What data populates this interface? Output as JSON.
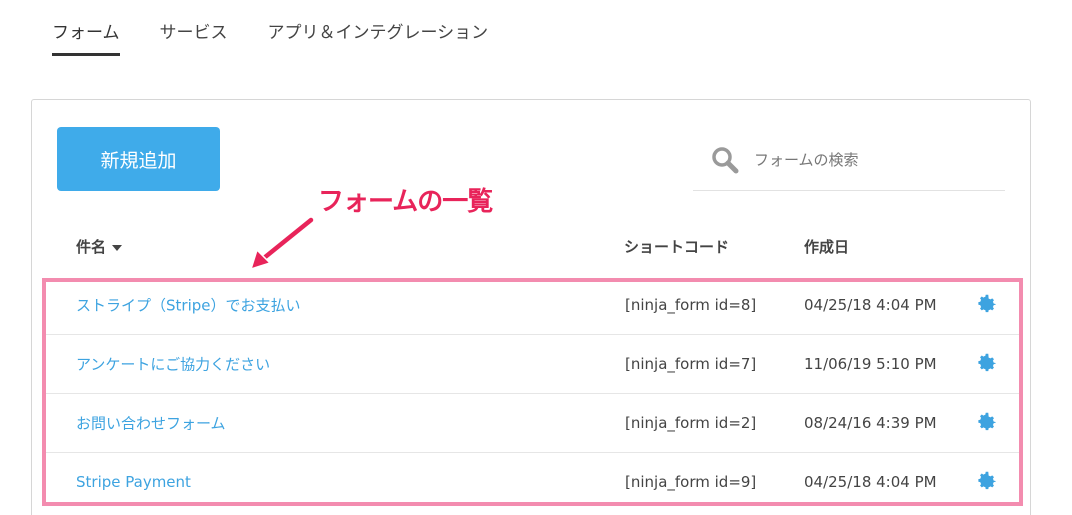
{
  "tabs": [
    {
      "label": "フォーム",
      "active": true
    },
    {
      "label": "サービス",
      "active": false
    },
    {
      "label": "アプリ＆インテグレーション",
      "active": false
    }
  ],
  "toolbar": {
    "add_label": "新規追加",
    "search_placeholder": "フォームの検索"
  },
  "annotation": {
    "text": "フォームの一覧",
    "color": "#e8245a"
  },
  "table": {
    "columns": {
      "title": "件名",
      "shortcode": "ショートコード",
      "date": "作成日"
    },
    "rows": [
      {
        "title": "ストライプ（Stripe）でお支払い",
        "shortcode": "[ninja_form id=8]",
        "date": "04/25/18 4:04 PM",
        "icon": "gear-icon"
      },
      {
        "title": "アンケートにご協力ください",
        "shortcode": "[ninja_form id=7]",
        "date": "11/06/19 5:10 PM",
        "icon": "gear-icon"
      },
      {
        "title": "お問い合わせフォーム",
        "shortcode": "[ninja_form id=2]",
        "date": "08/24/16 4:39 PM",
        "icon": "gear-icon"
      },
      {
        "title": "Stripe Payment",
        "shortcode": "[ninja_form id=9]",
        "date": "04/25/18 4:04 PM",
        "icon": "gear-icon"
      }
    ]
  },
  "colors": {
    "accent": "#3fabea",
    "link": "#3da3e0",
    "highlight_border": "#f38caf"
  }
}
